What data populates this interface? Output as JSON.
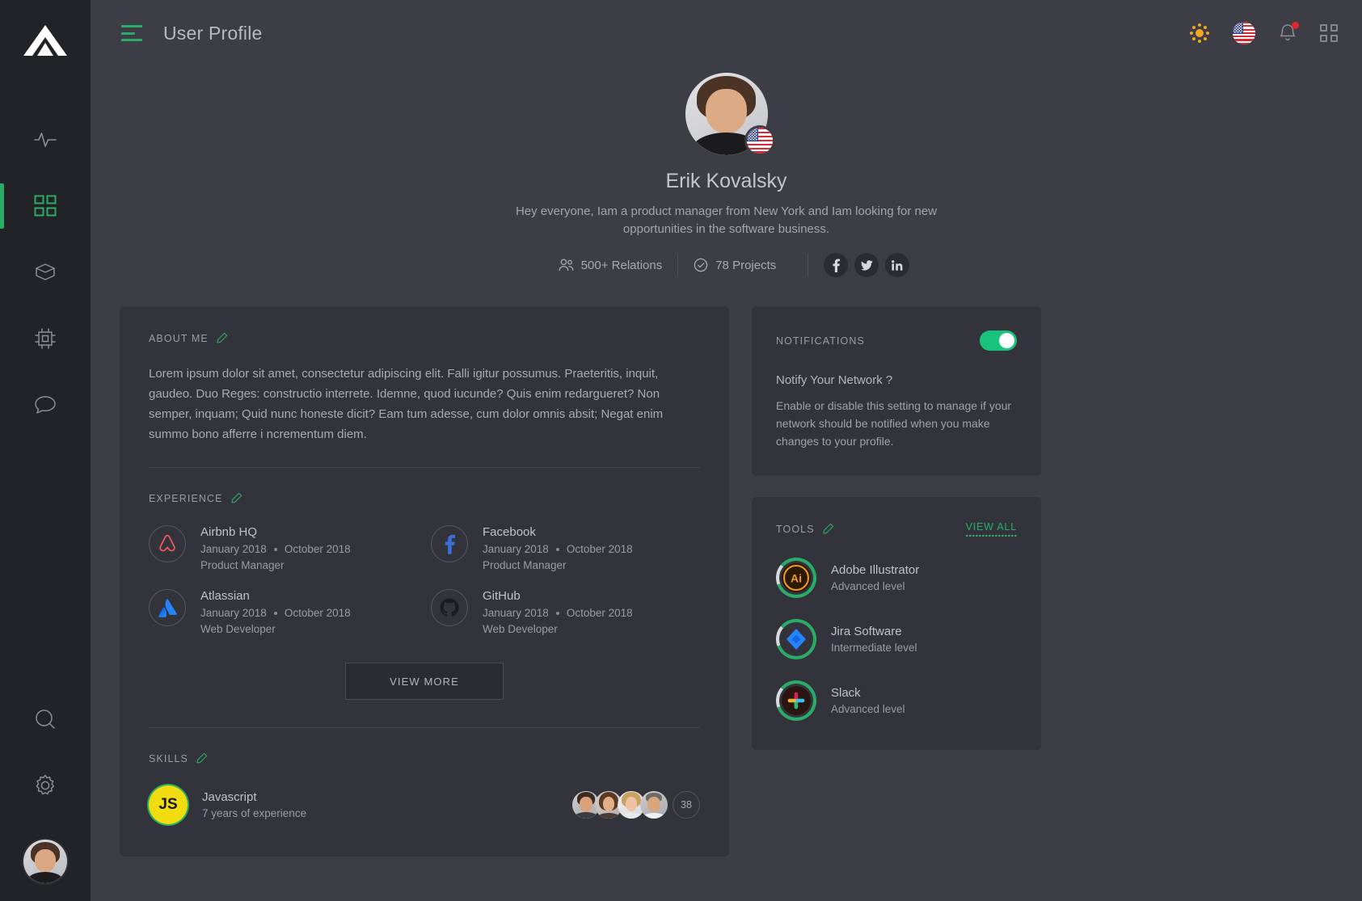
{
  "rail": {
    "logo_icon": "triangle-logo-icon",
    "items": [
      {
        "icon": "activity-pulse-icon",
        "name": "activity",
        "active": false
      },
      {
        "icon": "grid-dashboard-icon",
        "name": "dashboard",
        "active": true
      },
      {
        "icon": "cube-box-icon",
        "name": "products",
        "active": false
      },
      {
        "icon": "chip-cpu-icon",
        "name": "devices",
        "active": false
      },
      {
        "icon": "chat-bubble-icon",
        "name": "messages",
        "active": false
      }
    ],
    "bottom_items": [
      {
        "icon": "search-icon",
        "name": "search"
      },
      {
        "icon": "gear-settings-icon",
        "name": "settings"
      }
    ],
    "avatar_name": "rail-user-avatar"
  },
  "header": {
    "menu_icon": "hamburger-menu-icon",
    "title": "User Profile",
    "actions": [
      {
        "icon": "brightness-sun-icon",
        "name": "theme-toggle"
      },
      {
        "icon": "us-flag-icon",
        "name": "language-selector"
      },
      {
        "icon": "bell-notification-icon",
        "name": "notifications",
        "has_dot": true
      },
      {
        "icon": "grid-apps-icon",
        "name": "apps-menu"
      }
    ]
  },
  "profile": {
    "avatar_name": "profile-avatar",
    "flag_icon": "us-flag-badge-icon",
    "name": "Erik Kovalsky",
    "bio": "Hey everyone,  Iam a product manager from New York and Iam looking for new opportunities in the software business.",
    "stats": [
      {
        "icon": "users-group-icon",
        "label": "500+ Relations"
      },
      {
        "icon": "check-circle-icon",
        "label": "78 Projects"
      }
    ],
    "socials": [
      {
        "icon": "facebook-icon",
        "name": "facebook-link"
      },
      {
        "icon": "twitter-icon",
        "name": "twitter-link"
      },
      {
        "icon": "linkedin-icon",
        "name": "linkedin-link"
      }
    ]
  },
  "about": {
    "title": "ABOUT ME",
    "edit_icon": "pencil-edit-icon",
    "text": "Lorem ipsum dolor sit amet, consectetur adipiscing elit. Falli igitur possumus. Praeteritis, inquit, gaudeo. Duo Reges: constructio interrete. Idemne, quod iucunde? Quis enim redargueret? Non semper, inquam; Quid nunc honeste dicit? Eam tum adesse, cum dolor omnis absit; Negat enim summo bono afferre i ncrementum diem."
  },
  "experience": {
    "title": "EXPERIENCE",
    "edit_icon": "pencil-edit-icon",
    "items": [
      {
        "company": "Airbnb HQ",
        "logo": "airbnb-logo-icon",
        "start": "January 2018",
        "end": "October 2018",
        "role": "Product Manager"
      },
      {
        "company": "Facebook",
        "logo": "facebook-logo-icon",
        "start": "January 2018",
        "end": "October 2018",
        "role": "Product Manager"
      },
      {
        "company": "Atlassian",
        "logo": "atlassian-logo-icon",
        "start": "January 2018",
        "end": "October 2018",
        "role": "Web Developer"
      },
      {
        "company": "GitHub",
        "logo": "github-logo-icon",
        "start": "January 2018",
        "end": "October 2018",
        "role": "Web Developer"
      }
    ],
    "view_more_label": "VIEW MORE"
  },
  "skills": {
    "title": "SKILLS",
    "edit_icon": "pencil-edit-icon",
    "items": [
      {
        "badge_text": "JS",
        "name": "Javascript",
        "experience": "7 years of experience",
        "people_count": "38",
        "people": [
          "person-avatar-1",
          "person-avatar-2",
          "person-avatar-3",
          "person-avatar-4"
        ]
      }
    ]
  },
  "notifications": {
    "title": "NOTIFICATIONS",
    "toggle_on": true,
    "question": "Notify Your Network ?",
    "description": "Enable or disable this setting to manage if your network should be notified when you make changes to your profile."
  },
  "tools": {
    "title": "TOOLS",
    "edit_icon": "pencil-edit-icon",
    "view_all_label": "VIEW ALL",
    "items": [
      {
        "name": "Adobe Illustrator",
        "level": "Advanced level",
        "icon": "adobe-illustrator-icon"
      },
      {
        "name": "Jira Software",
        "level": "Intermediate level",
        "icon": "jira-software-icon"
      },
      {
        "name": "Slack",
        "level": "Advanced level",
        "icon": "slack-icon"
      }
    ]
  },
  "colors": {
    "accent_green": "#2bab68",
    "toggle_green": "#19c37d",
    "page_bg": "#3c3d45",
    "card_bg": "#33343b",
    "rail_bg": "#222327",
    "notification_dot": "#e0262f"
  }
}
